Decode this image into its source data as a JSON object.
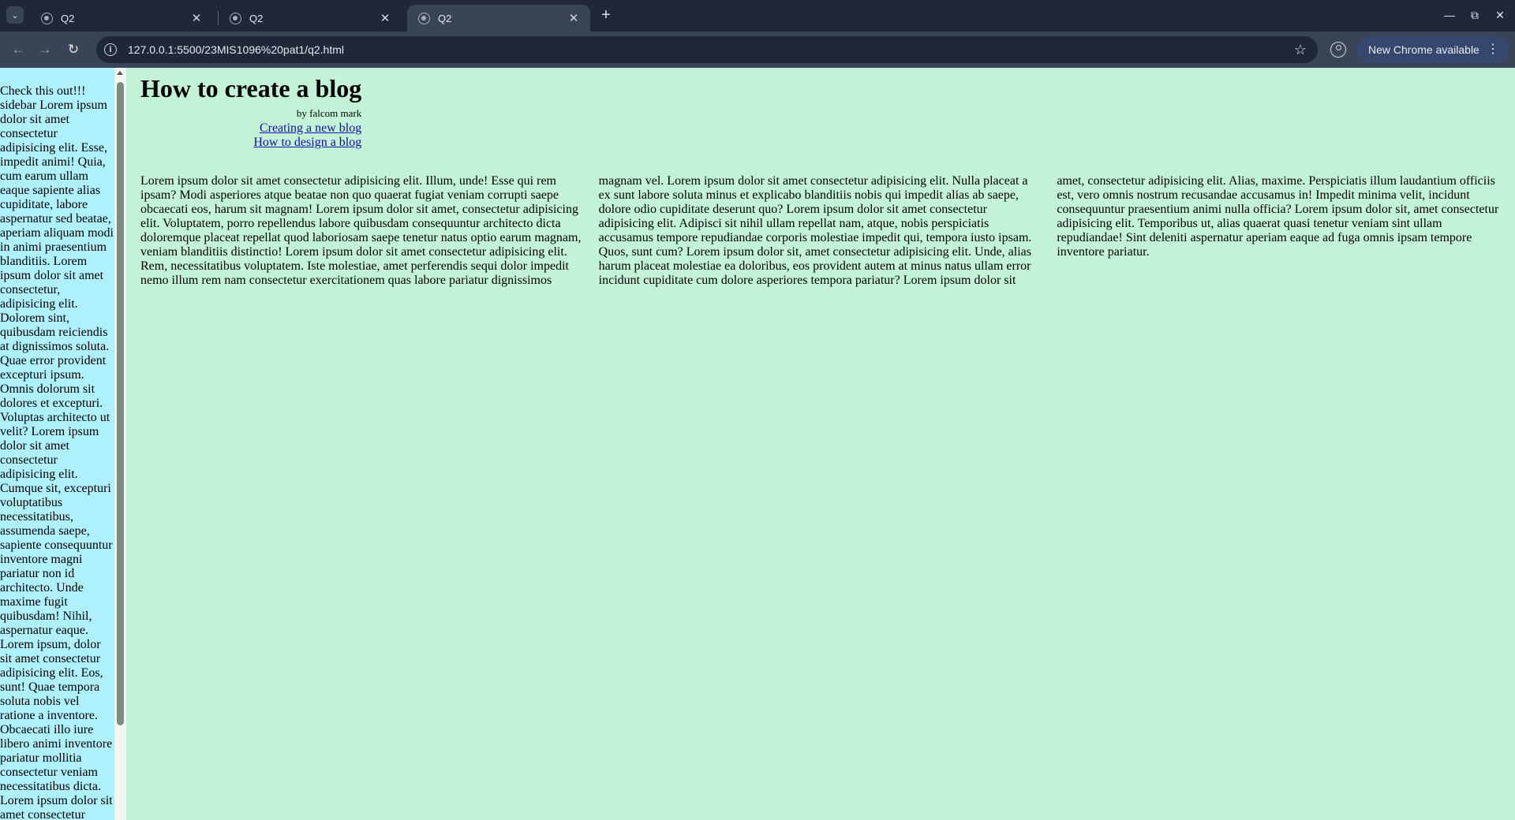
{
  "browser": {
    "tabs": [
      {
        "title": "Q2",
        "active": false
      },
      {
        "title": "Q2",
        "active": false
      },
      {
        "title": "Q2",
        "active": true
      }
    ],
    "url": "127.0.0.1:5500/23MIS1096%20pat1/q2.html",
    "update_label": "New Chrome available"
  },
  "page": {
    "sidebar_text": "Check this out!!! sidebar Lorem ipsum dolor sit amet consectetur adipisicing elit. Esse, impedit animi! Quia, cum earum ullam eaque sapiente alias cupiditate, labore aspernatur sed beatae, aperiam aliquam modi in animi praesentium blanditiis. Lorem ipsum dolor sit amet consectetur, adipisicing elit. Dolorem sint, quibusdam reiciendis at dignissimos soluta. Quae error provident excepturi ipsum. Omnis dolorum sit dolores et excepturi. Voluptas architecto ut velit? Lorem ipsum dolor sit amet consectetur adipisicing elit. Cumque sit, excepturi voluptatibus necessitatibus, assumenda saepe, sapiente consequuntur inventore magni pariatur non id architecto. Unde maxime fugit quibusdam! Nihil, aspernatur eaque. Lorem ipsum, dolor sit amet consectetur adipisicing elit. Eos, sunt! Quae tempora soluta nobis vel ratione a inventore. Obcaecati illo iure libero animi inventore pariatur mollitia consectetur veniam necessitatibus dicta. Lorem ipsum dolor sit amet consectetur",
    "title": "How to create a blog",
    "byline": "by falcom mark",
    "links": [
      "Creating a new blog",
      "How to design a blog"
    ],
    "body_text": "Lorem ipsum dolor sit amet consectetur adipisicing elit. Illum, unde! Esse qui rem ipsam? Modi asperiores atque beatae non quo quaerat fugiat veniam corrupti saepe obcaecati eos, harum sit magnam! Lorem ipsum dolor sit amet, consectetur adipisicing elit. Voluptatem, porro repellendus labore quibusdam consequuntur architecto dicta doloremque placeat repellat quod laboriosam saepe tenetur natus optio earum magnam, veniam blanditiis distinctio! Lorem ipsum dolor sit amet consectetur adipisicing elit. Rem, necessitatibus voluptatem. Iste molestiae, amet perferendis sequi dolor impedit nemo illum rem nam consectetur exercitationem quas labore pariatur dignissimos magnam vel. Lorem ipsum dolor sit amet consectetur adipisicing elit. Nulla placeat a ex sunt labore soluta minus et explicabo blanditiis nobis qui impedit alias ab saepe, dolore odio cupiditate deserunt quo? Lorem ipsum dolor sit amet consectetur adipisicing elit. Adipisci sit nihil ullam repellat nam, atque, nobis perspiciatis accusamus tempore repudiandae corporis molestiae impedit qui, tempora iusto ipsam. Quos, sunt cum? Lorem ipsum dolor sit, amet consectetur adipisicing elit. Unde, alias harum placeat molestiae ea doloribus, eos provident autem at minus natus ullam error incidunt cupiditate cum dolore asperiores tempora pariatur? Lorem ipsum dolor sit amet, consectetur adipisicing elit. Alias, maxime. Perspiciatis illum laudantium officiis est, vero omnis nostrum recusandae accusamus in! Impedit minima velit, incidunt consequuntur praesentium animi nulla officia? Lorem ipsum dolor sit, amet consectetur adipisicing elit. Temporibus ut, alias quaerat quasi tenetur veniam sint ullam repudiandae! Sint deleniti aspernatur aperiam eaque ad fuga omnis ipsam tempore inventore pariatur."
  },
  "colors": {
    "page_background": "#c3f3d6",
    "sidebar_background": "#aef0fb",
    "browser_frame": "#1f2838",
    "toolbar": "#3a4457",
    "link": "#1a0dab"
  },
  "icons": [
    "tab-search-icon",
    "globe-icon",
    "close-icon",
    "new-tab-icon",
    "minimize-icon",
    "maximize-icon",
    "window-close-icon",
    "back-icon",
    "forward-icon",
    "reload-icon",
    "site-info-icon",
    "bookmark-star-icon",
    "profile-icon",
    "menu-kebab-icon"
  ]
}
